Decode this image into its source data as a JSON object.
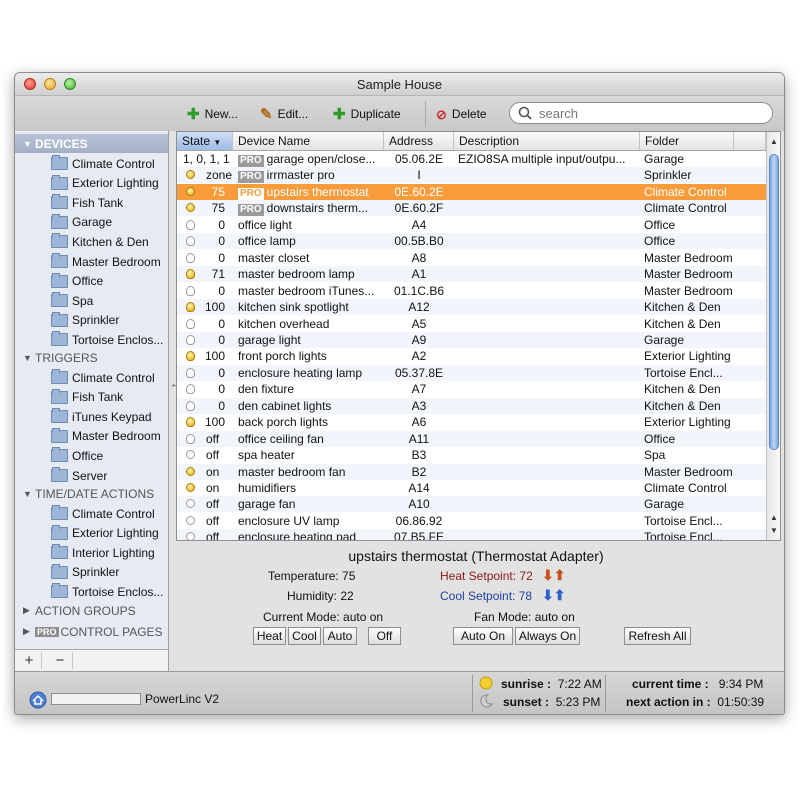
{
  "window": {
    "title": "Sample House"
  },
  "toolbar": {
    "new_label": "New...",
    "edit_label": "Edit...",
    "duplicate_label": "Duplicate",
    "delete_label": "Delete",
    "search_placeholder": "search"
  },
  "sidebar": {
    "devices": {
      "label": "DEVICES",
      "items": [
        "Climate Control",
        "Exterior Lighting",
        "Fish Tank",
        "Garage",
        "Kitchen & Den",
        "Master Bedroom",
        "Office",
        "Spa",
        "Sprinkler",
        "Tortoise Enclos..."
      ]
    },
    "triggers": {
      "label": "TRIGGERS",
      "items": [
        "Climate Control",
        "Fish Tank",
        "iTunes Keypad",
        "Master Bedroom",
        "Office",
        "Server"
      ]
    },
    "time_date": {
      "label": "TIME/DATE ACTIONS",
      "items": [
        "Climate Control",
        "Exterior Lighting",
        "Interior Lighting",
        "Sprinkler",
        "Tortoise Enclos..."
      ]
    },
    "action_groups": {
      "label": "ACTION GROUPS"
    },
    "control_pages": {
      "pro": "PRO",
      "label": "CONTROL PAGES"
    },
    "add_label": "+",
    "remove_label": "−"
  },
  "table": {
    "columns": {
      "state": "State",
      "name": "Device Name",
      "address": "Address",
      "description": "Description",
      "folder": "Folder"
    },
    "rows": [
      {
        "icon": "none",
        "state": "1, 0, 1, 1",
        "pro": false,
        "name": "garage open/close...",
        "name_pro": true,
        "address": "05.06.2E",
        "description": "EZIO8SA multiple input/outpu...",
        "folder": "Garage"
      },
      {
        "icon": "on-dot",
        "state": "zone",
        "name": "irrmaster pro",
        "name_pro": true,
        "address": "I",
        "description": "",
        "folder": "Sprinkler"
      },
      {
        "icon": "on-dot",
        "state": "75",
        "name": "upstairs thermostat",
        "name_pro": true,
        "address": "0E.60.2E",
        "description": "",
        "folder": "Climate Control",
        "selected": true
      },
      {
        "icon": "on-dot",
        "state": "75",
        "name": "downstairs therm...",
        "name_pro": true,
        "address": "0E.60.2F",
        "description": "",
        "folder": "Climate Control"
      },
      {
        "icon": "off",
        "state": "0",
        "name": "office light",
        "address": "A4",
        "description": "",
        "folder": "Office"
      },
      {
        "icon": "off",
        "state": "0",
        "name": "office lamp",
        "address": "00.5B.B0",
        "description": "",
        "folder": "Office"
      },
      {
        "icon": "off",
        "state": "0",
        "name": "master closet",
        "address": "A8",
        "description": "",
        "folder": "Master Bedroom"
      },
      {
        "icon": "on",
        "state": "71",
        "name": "master bedroom lamp",
        "address": "A1",
        "description": "",
        "folder": "Master Bedroom"
      },
      {
        "icon": "off",
        "state": "0",
        "name": "master bedroom iTunes...",
        "address": "01.1C.B6",
        "description": "",
        "folder": "Master Bedroom"
      },
      {
        "icon": "on",
        "state": "100",
        "name": "kitchen sink spotlight",
        "address": "A12",
        "description": "",
        "folder": "Kitchen & Den"
      },
      {
        "icon": "off",
        "state": "0",
        "name": "kitchen overhead",
        "address": "A5",
        "description": "",
        "folder": "Kitchen & Den"
      },
      {
        "icon": "off",
        "state": "0",
        "name": "garage light",
        "address": "A9",
        "description": "",
        "folder": "Garage"
      },
      {
        "icon": "on",
        "state": "100",
        "name": "front porch lights",
        "address": "A2",
        "description": "",
        "folder": "Exterior Lighting"
      },
      {
        "icon": "off",
        "state": "0",
        "name": "enclosure heating lamp",
        "address": "05.37.8E",
        "description": "",
        "folder": "Tortoise Encl..."
      },
      {
        "icon": "off",
        "state": "0",
        "name": "den fixture",
        "address": "A7",
        "description": "",
        "folder": "Kitchen & Den"
      },
      {
        "icon": "off",
        "state": "0",
        "name": "den cabinet lights",
        "address": "A3",
        "description": "",
        "folder": "Kitchen & Den"
      },
      {
        "icon": "on",
        "state": "100",
        "name": "back porch lights",
        "address": "A6",
        "description": "",
        "folder": "Exterior Lighting"
      },
      {
        "icon": "off",
        "state": "off",
        "name": "office ceiling fan",
        "address": "A11",
        "description": "",
        "folder": "Office"
      },
      {
        "icon": "off-dot",
        "state": "off",
        "name": "spa heater",
        "address": "B3",
        "description": "",
        "folder": "Spa"
      },
      {
        "icon": "on-dot",
        "state": "on",
        "name": "master bedroom fan",
        "address": "B2",
        "description": "",
        "folder": "Master Bedroom"
      },
      {
        "icon": "on-dot",
        "state": "on",
        "name": "humidifiers",
        "address": "A14",
        "description": "",
        "folder": "Climate Control"
      },
      {
        "icon": "off-dot",
        "state": "off",
        "name": "garage fan",
        "address": "A10",
        "description": "",
        "folder": "Garage"
      },
      {
        "icon": "off-dot",
        "state": "off",
        "name": "enclosure UV lamp",
        "address": "06.86.92",
        "description": "",
        "folder": "Tortoise Encl..."
      },
      {
        "icon": "off-dot",
        "state": "off",
        "name": "enclosure heating pad",
        "address": "07.B5.FE",
        "description": "",
        "folder": "Tortoise Encl..."
      }
    ]
  },
  "detail": {
    "title": "upstairs thermostat (Thermostat Adapter)",
    "temperature_label": "Temperature:",
    "temperature": "75",
    "humidity_label": "Humidity:",
    "humidity": "22",
    "heat_label": "Heat Setpoint:",
    "heat": "72",
    "cool_label": "Cool Setpoint:",
    "cool": "78",
    "mode_label": "Current Mode:",
    "mode": "auto on",
    "fan_label": "Fan Mode:",
    "fan": "auto on",
    "buttons": {
      "heat": "Heat",
      "cool": "Cool",
      "auto": "Auto",
      "off": "Off",
      "fan_auto_on": "Auto On",
      "fan_always_on": "Always On",
      "refresh_all": "Refresh All"
    },
    "colors": {
      "heat": "#8b1a1a",
      "cool": "#1f3fa0"
    }
  },
  "status": {
    "interface": "PowerLinc V2",
    "sunrise_label": "sunrise :",
    "sunrise": "7:22 AM",
    "sunset_label": "sunset :",
    "sunset": "5:23 PM",
    "current_time_label": "current time :",
    "current_time": "9:34 PM",
    "next_action_label": "next action in :",
    "next_action": "01:50:39"
  }
}
